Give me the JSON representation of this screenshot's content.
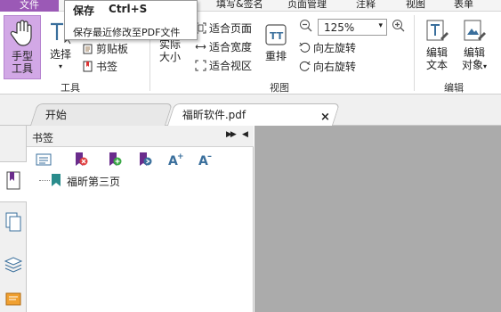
{
  "menubar": {
    "file": "文件",
    "items": [
      "填写&签名",
      "页面管理",
      "注释",
      "视图",
      "表单"
    ]
  },
  "tooltip": {
    "title": "保存",
    "shortcut": "Ctrl+S",
    "description": "保存最近修改至PDF文件"
  },
  "ribbon": {
    "tools_group": {
      "label": "工具",
      "hand_tool": [
        "手型",
        "工具"
      ],
      "select": "选择",
      "clipboard": "剪贴板",
      "bookmark": "书签"
    },
    "view_group": {
      "label": "视图",
      "actual_size": [
        "实际",
        "大小"
      ],
      "fit_page": "适合页面",
      "fit_width": "适合宽度",
      "fit_visible": "适合视区",
      "reflow": "重排",
      "zoom_value": "125%",
      "rotate_left": "向左旋转",
      "rotate_right": "向右旋转"
    },
    "edit_group": {
      "label": "编辑",
      "edit_text": [
        "编辑",
        "文本"
      ],
      "edit_object": [
        "编辑",
        "对象"
      ]
    }
  },
  "tabs": {
    "start": "开始",
    "document": "福昕软件.pdf",
    "close": "×"
  },
  "bookmarks": {
    "title": "书签",
    "expand": "▶▶",
    "collapse": "◀",
    "items": [
      {
        "label": "福昕第三页"
      }
    ]
  },
  "colors": {
    "accent": "#9b59b6",
    "active_tool_bg": "#d2a8e6",
    "doc_background": "#ababab",
    "bookmark_icon": "#2a8c8c"
  }
}
